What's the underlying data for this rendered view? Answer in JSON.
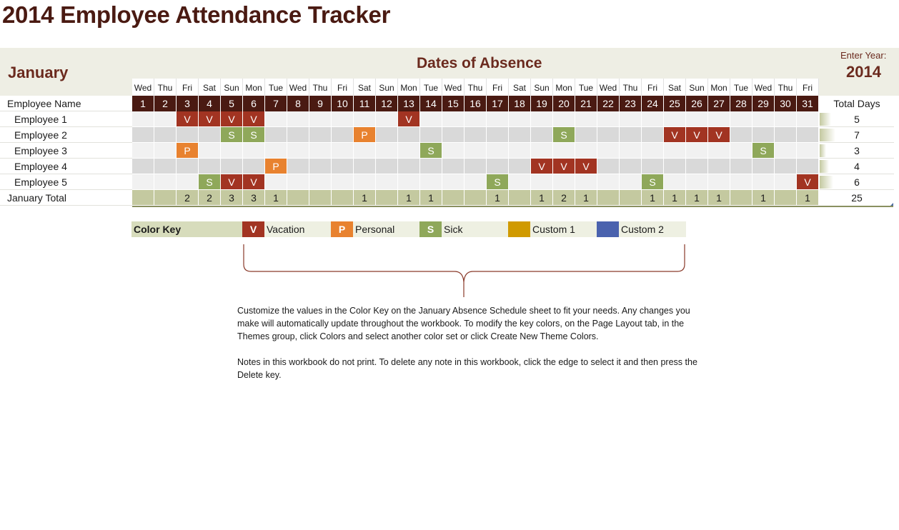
{
  "title": "2014 Employee Attendance Tracker",
  "month": "January",
  "section_title": "Dates of Absence",
  "year_label": "Enter Year:",
  "year": "2014",
  "header": {
    "name_col": "Employee Name",
    "total_col": "Total Days"
  },
  "days_of_week": [
    "Wed",
    "Thu",
    "Fri",
    "Sat",
    "Sun",
    "Mon",
    "Tue",
    "Wed",
    "Thu",
    "Fri",
    "Sat",
    "Sun",
    "Mon",
    "Tue",
    "Wed",
    "Thu",
    "Fri",
    "Sat",
    "Sun",
    "Mon",
    "Tue",
    "Wed",
    "Thu",
    "Fri",
    "Sat",
    "Sun",
    "Mon",
    "Tue",
    "Wed",
    "Thu",
    "Fri"
  ],
  "days": [
    "1",
    "2",
    "3",
    "4",
    "5",
    "6",
    "7",
    "8",
    "9",
    "10",
    "11",
    "12",
    "13",
    "14",
    "15",
    "16",
    "17",
    "18",
    "19",
    "20",
    "21",
    "22",
    "23",
    "24",
    "25",
    "26",
    "27",
    "28",
    "29",
    "30",
    "31"
  ],
  "employees": [
    {
      "name": "Employee 1",
      "total": 5,
      "absences": {
        "3": "V",
        "4": "V",
        "5": "V",
        "6": "V",
        "13": "V"
      }
    },
    {
      "name": "Employee 2",
      "total": 7,
      "absences": {
        "5": "S",
        "6": "S",
        "11": "P",
        "20": "S",
        "25": "V",
        "26": "V",
        "27": "V"
      }
    },
    {
      "name": "Employee 3",
      "total": 3,
      "absences": {
        "3": "P",
        "14": "S",
        "29": "S"
      }
    },
    {
      "name": "Employee 4",
      "total": 4,
      "absences": {
        "7": "P",
        "19": "V",
        "20": "V",
        "21": "V"
      }
    },
    {
      "name": "Employee 5",
      "total": 6,
      "absences": {
        "4": "S",
        "5": "V",
        "6": "V",
        "17": "S",
        "24": "S",
        "31": "V"
      }
    }
  ],
  "total_row": {
    "label": "January Total",
    "daily": {
      "3": "2",
      "4": "2",
      "5": "3",
      "6": "3",
      "7": "1",
      "11": "1",
      "13": "1",
      "14": "1",
      "17": "1",
      "19": "1",
      "20": "2",
      "21": "1",
      "24": "1",
      "25": "1",
      "26": "1",
      "27": "1",
      "29": "1",
      "31": "1"
    },
    "grand_total": "25"
  },
  "max_total": 25,
  "color_key": {
    "label": "Color Key",
    "items": [
      {
        "code": "V",
        "label": "Vacation",
        "color": "#a23422"
      },
      {
        "code": "P",
        "label": "Personal",
        "color": "#e8822f"
      },
      {
        "code": "S",
        "label": "Sick",
        "color": "#8fa85a"
      },
      {
        "code": "",
        "label": "Custom 1",
        "color": "#d09a00"
      },
      {
        "code": "",
        "label": "Custom 2",
        "color": "#4a62ae"
      }
    ]
  },
  "notes": [
    "Customize the values in the Color Key on the January Absence Schedule sheet to fit your needs. Any changes you make will automatically update throughout the workbook.  To modify the key colors, on the Page Layout tab, in the Themes group, click Colors and select another color set or click Create New Theme Colors.",
    "Notes in this workbook do not print. To delete any note in this workbook, click the edge to select it and then press the Delete key."
  ]
}
